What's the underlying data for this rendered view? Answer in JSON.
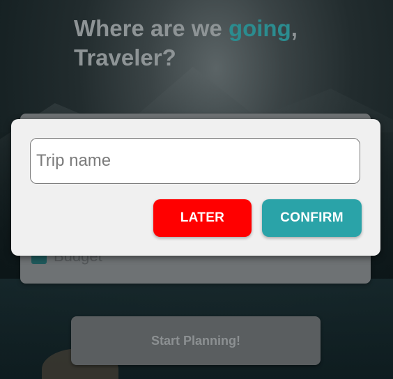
{
  "header": {
    "title_part1": "Where are we ",
    "title_accent": "going",
    "title_part2": ",",
    "title_line2": "Traveler?"
  },
  "form": {
    "budget_label": "Budget",
    "start_button_label": "Start Planning!"
  },
  "modal": {
    "trip_name_placeholder": "Trip name",
    "trip_name_value": "",
    "later_label": "LATER",
    "confirm_label": "CONFIRM"
  },
  "colors": {
    "accent": "#2b8c8f",
    "later_button": "#ff0000",
    "confirm_button": "#2aa3a8",
    "modal_background": "#f0f0f0"
  }
}
